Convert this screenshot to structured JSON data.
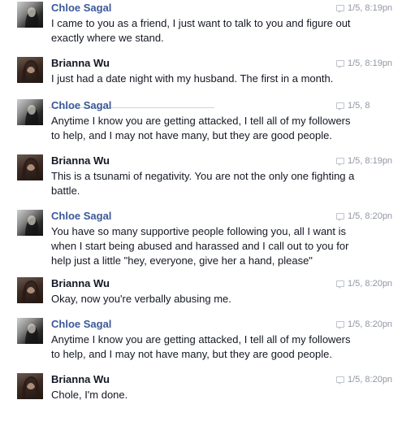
{
  "messages": [
    {
      "sender": "Chloe Sagal",
      "time": "1/5, 8:19pn",
      "text": "I came to you as a friend, I just want to talk to you and figure out exactly where we stand."
    },
    {
      "sender": "Brianna Wu",
      "time": "1/5, 8:19pn",
      "text": "I just had a date night with my husband. The first in a month."
    },
    {
      "sender": "Chloe Sagal",
      "time": "1/5, 8",
      "text": "Anytime I know you are getting attacked, I tell all of my followers to help, and I may not have many, but they are good people."
    },
    {
      "sender": "Brianna Wu",
      "time": "1/5, 8:19pn",
      "text": "This is a tsunami of negativity. You are not the only one fighting a battle."
    },
    {
      "sender": "Chloe Sagal",
      "time": "1/5, 8:20pn",
      "text": "You have so many supportive people following you, all I want is when I start being abused and harassed and I call out to you for help just a little \"hey, everyone, give her a hand, please\""
    },
    {
      "sender": "Brianna Wu",
      "time": "1/5, 8:20pn",
      "text": "Okay, now you're verbally abusing me."
    },
    {
      "sender": "Chloe Sagal",
      "time": "1/5, 8:20pn",
      "text": "Anytime I know you are getting attacked, I tell all of my followers to help, and I may not have many, but they are good people."
    },
    {
      "sender": "Brianna Wu",
      "time": "1/5, 8:20pn",
      "text": "Chole, I'm done."
    }
  ],
  "colors": {
    "sender_link": "#3b5998",
    "sender_plain": "#141823",
    "timestamp": "#9197a3",
    "body_text": "#141823"
  },
  "icons": {
    "message": "chat-bubble-icon"
  }
}
